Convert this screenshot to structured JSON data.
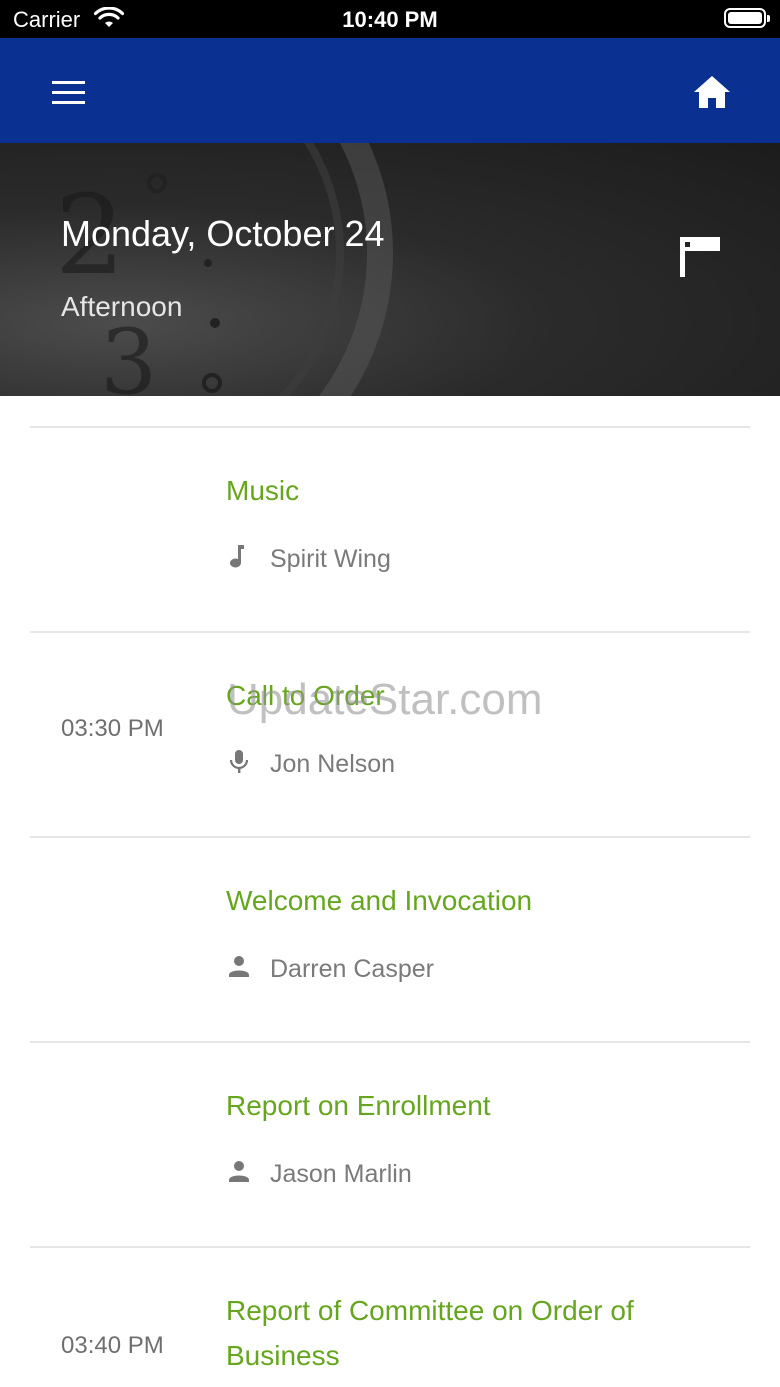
{
  "status_bar": {
    "carrier": "Carrier",
    "time": "10:40 PM"
  },
  "app_bar": {
    "background": "#0a3191",
    "menu_icon": "hamburger-menu-icon",
    "home_icon": "home-icon"
  },
  "header": {
    "date": "Monday, October 24",
    "session": "Afternoon",
    "flag_icon": "flag-icon"
  },
  "agenda": [
    {
      "time": "",
      "title": "Music",
      "person_icon": "music-note-icon",
      "person": "Spirit Wing"
    },
    {
      "time": "03:30 PM",
      "title": "Call to Order",
      "person_icon": "microphone-icon",
      "person": "Jon Nelson"
    },
    {
      "time": "",
      "title": "Welcome and Invocation",
      "person_icon": "person-icon",
      "person": "Darren Casper"
    },
    {
      "time": "",
      "title": "Report on Enrollment",
      "person_icon": "person-icon",
      "person": "Jason Marlin"
    },
    {
      "time": "03:40 PM",
      "title": "Report of Committee on Order of Business",
      "person_icon": "",
      "person": ""
    }
  ],
  "watermark": "UpdateStar.com",
  "colors": {
    "accent_green": "#66a61e",
    "secondary_text": "#7a7a7a"
  }
}
